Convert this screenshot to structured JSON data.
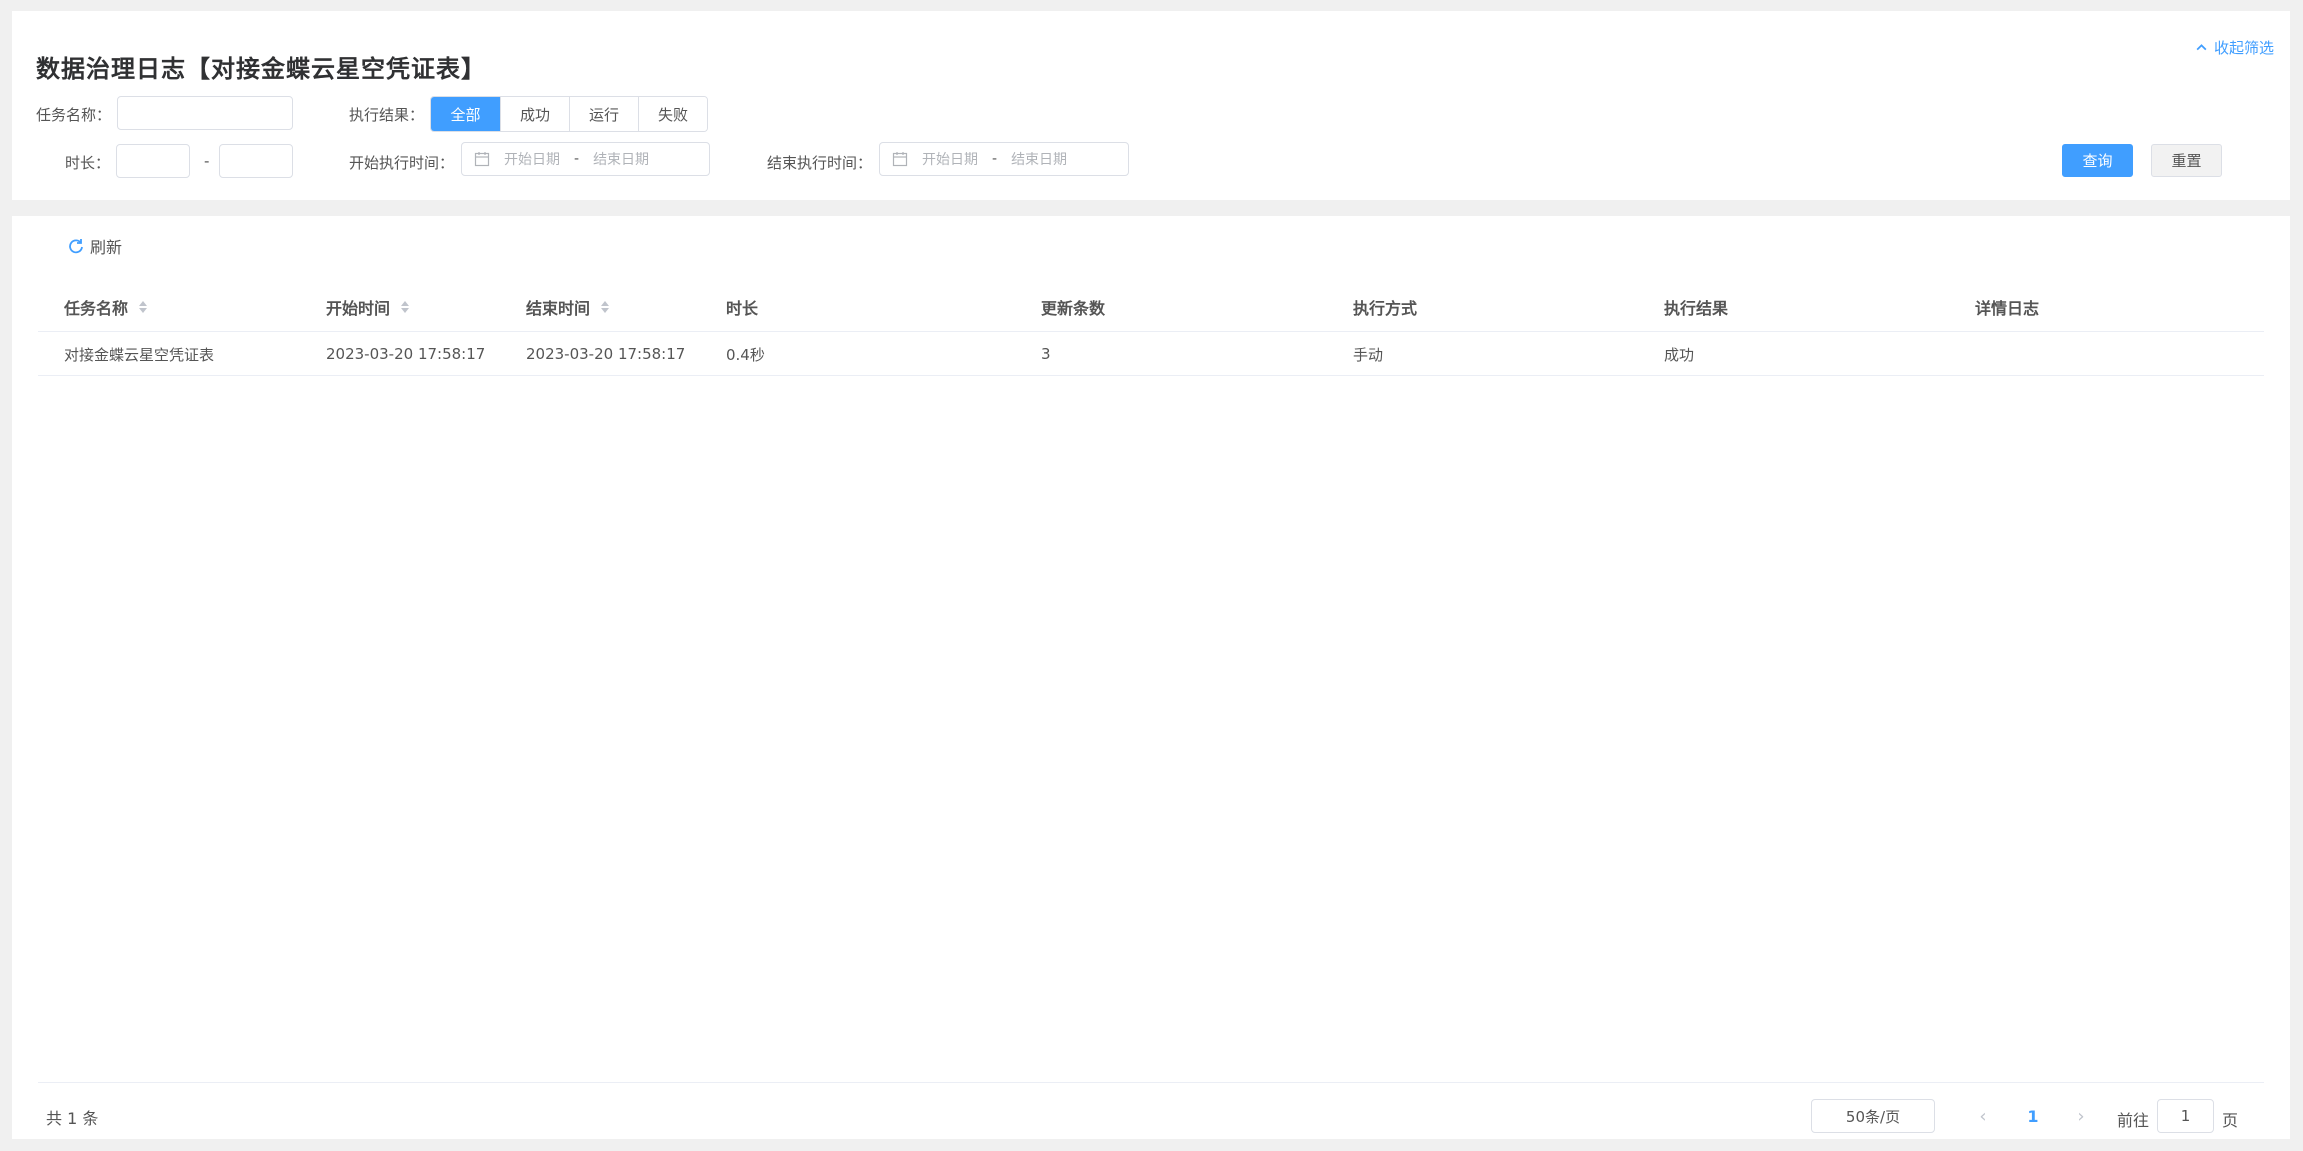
{
  "filter": {
    "title": "数据治理日志【对接金蝶云星空凭证表】",
    "collapse_label": "收起筛选",
    "task_name_label": "任务名称：",
    "task_name_value": "",
    "result_label": "执行结果：",
    "result_options": [
      "全部",
      "成功",
      "运行",
      "失败"
    ],
    "result_selected": "全部",
    "duration_label": "时长：",
    "duration_min": "",
    "duration_max": "",
    "range_sep": "-",
    "start_time_label": "开始执行时间：",
    "end_time_label": "结束执行时间：",
    "start_date_placeholder": "开始日期",
    "end_date_placeholder": "结束日期",
    "query_label": "查询",
    "reset_label": "重置"
  },
  "table": {
    "refresh_label": "刷新",
    "columns": [
      "任务名称",
      "开始时间",
      "结束时间",
      "时长",
      "更新条数",
      "执行方式",
      "执行结果",
      "详情日志"
    ],
    "rows": [
      [
        "对接金蝶云星空凭证表",
        "2023-03-20 17:58:17",
        "2023-03-20 17:58:17",
        "0.4秒",
        "3",
        "手动",
        "成功",
        ""
      ]
    ]
  },
  "pagination": {
    "total_label": "共 1 条",
    "page_size": "50条/页",
    "current_page": "1",
    "goto_prefix": "前往",
    "goto_value": "1",
    "goto_suffix": "页"
  },
  "colors": {
    "primary": "#409eff",
    "border": "#dcdfe6",
    "bg": "#f0f0f0"
  }
}
